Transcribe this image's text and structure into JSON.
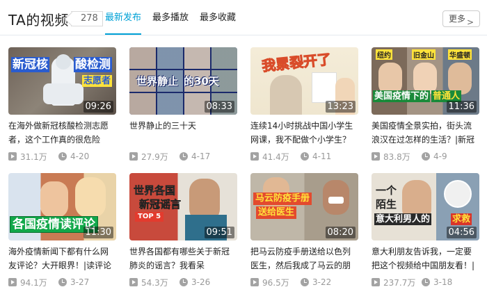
{
  "header": {
    "title": "TA的视频",
    "count": "278",
    "tabs": [
      {
        "label": "最新发布",
        "active": true
      },
      {
        "label": "最多播放",
        "active": false
      },
      {
        "label": "最多收藏",
        "active": false
      }
    ],
    "more_label": "更多"
  },
  "colors": {
    "accent": "#00a1d6",
    "meta": "#999999"
  },
  "videos": [
    {
      "title": "在海外做新冠核酸检测志愿者，这个工作真的很危险么？",
      "duration": "09:26",
      "views": "31.1万",
      "date": "4-20",
      "thumb_caption": [
        "新冠核",
        "酸检测",
        "志愿者"
      ]
    },
    {
      "title": "世界静止的三十天",
      "duration": "08:33",
      "views": "27.9万",
      "date": "4-17",
      "thumb_caption": [
        "世界静止",
        "的30天"
      ]
    },
    {
      "title": "连续14小时挑战中国小学生网课，我不配做个小学生？",
      "duration": "13:23",
      "views": "41.4万",
      "date": "4-11",
      "thumb_caption": [
        "我累裂开了"
      ]
    },
    {
      "title": "美国疫情全景实拍，街头流浪汉在过怎样的生活？|新冠肺",
      "duration": "11:36",
      "views": "83.8万",
      "date": "4-9",
      "thumb_caption": [
        "美国疫情下的",
        "普通人",
        "纽约",
        "旧金山",
        "华盛顿"
      ]
    },
    {
      "title": "海外疫情新闻下都有什么网友评论？大开眼界！|读评论",
      "duration": "11:30",
      "views": "94.1万",
      "date": "3-27",
      "thumb_caption": [
        "各国疫情读评论"
      ]
    },
    {
      "title": "世界各国都有哪些关于新冠肺炎的谣言？我看呆了！|TOP",
      "duration": "09:51",
      "views": "54.3万",
      "date": "3-26",
      "thumb_caption": [
        "世界各国",
        "新冠谣言",
        "TOP 5"
      ]
    },
    {
      "title": "把马云防疫手册送给以色列医生，然后我成了马云的朋友|",
      "duration": "08:20",
      "views": "96.5万",
      "date": "3-22",
      "thumb_caption": [
        "马云防疫手册",
        "送给医生"
      ]
    },
    {
      "title": "意大利朋友告诉我，一定要把这个视频给中国朋友看！|新",
      "duration": "04:56",
      "views": "237.7万",
      "date": "3-18",
      "thumb_caption": [
        "一个",
        "陌生",
        "意大利男人的",
        "求救"
      ]
    }
  ]
}
